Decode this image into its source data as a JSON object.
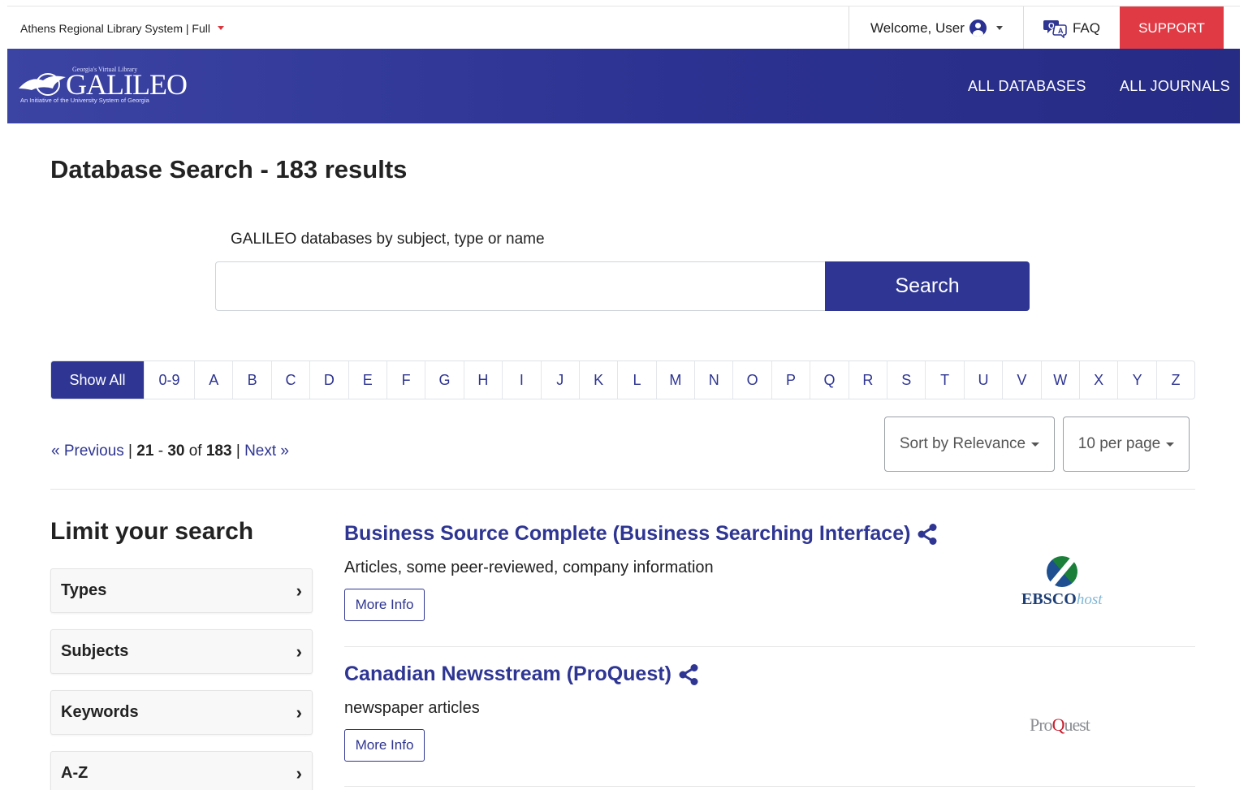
{
  "topbar": {
    "institution": "Athens Regional Library System | Full",
    "welcome": "Welcome, User",
    "faq": "FAQ",
    "support": "SUPPORT"
  },
  "banner": {
    "logo_tagline": "Georgia's Virtual Library",
    "logo_word": "GALILEO",
    "logo_subline": "An Initiative of the University System of Georgia",
    "nav": [
      "ALL DATABASES",
      "ALL JOURNALS"
    ]
  },
  "page_title": "Database Search - 183 results",
  "search": {
    "label": "GALILEO databases by subject, type or name",
    "value": "",
    "button": "Search"
  },
  "letters": [
    "Show All",
    "0-9",
    "A",
    "B",
    "C",
    "D",
    "E",
    "F",
    "G",
    "H",
    "I",
    "J",
    "K",
    "L",
    "M",
    "N",
    "O",
    "P",
    "Q",
    "R",
    "S",
    "T",
    "U",
    "V",
    "W",
    "X",
    "Y",
    "Z"
  ],
  "active_letter": "Show All",
  "pagination": {
    "previous": "« Previous",
    "sep1": " | ",
    "range_start": "21",
    "dash": " - ",
    "range_end": "30",
    "of": " of ",
    "total": "183",
    "sep2": " | ",
    "next": "Next »"
  },
  "sort": {
    "selected": "Sort by Relevance"
  },
  "per_page": {
    "selected": "10 per page"
  },
  "sidebar": {
    "title": "Limit your search",
    "facets": [
      "Types",
      "Subjects",
      "Keywords",
      "A-Z"
    ]
  },
  "results": [
    {
      "title": "Business Source Complete (Business Searching Interface)",
      "description": "Articles, some peer-reviewed, company information",
      "button": "More Info",
      "vendor": "EBSCO",
      "vendor_suffix": "host"
    },
    {
      "title": "Canadian Newsstream (ProQuest)",
      "description": "newspaper articles",
      "button": "More Info",
      "vendor_a": "Pro",
      "vendor_b": "Q",
      "vendor_c": "uest"
    }
  ],
  "colors": {
    "primary": "#2e3592",
    "support": "#e03a45",
    "banner": "#2c3291"
  }
}
